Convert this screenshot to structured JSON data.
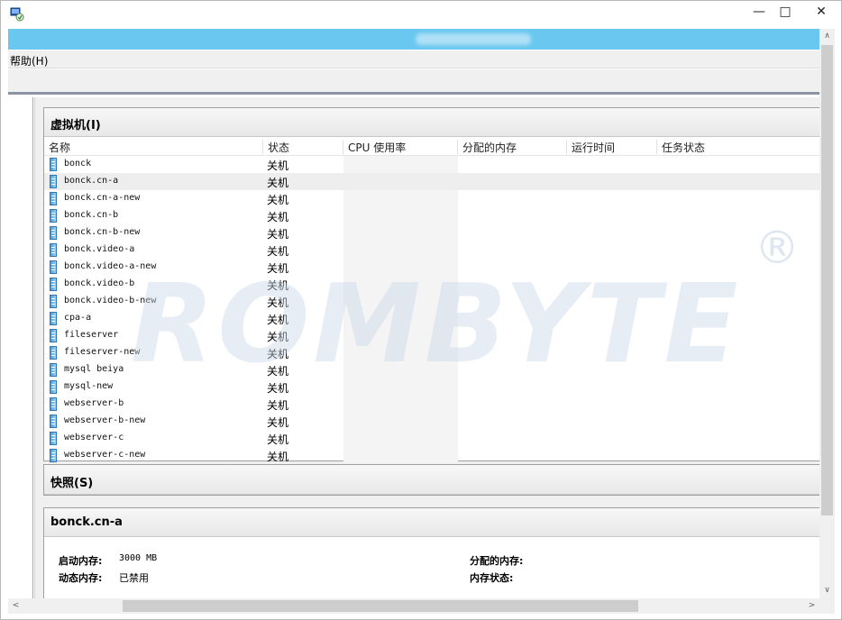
{
  "window": {
    "minimize": "—",
    "maximize": "□",
    "close": "✕"
  },
  "menu": {
    "help": "帮助(H)"
  },
  "vm_panel": {
    "title": "虚拟机(I)",
    "columns": [
      "名称",
      "状态",
      "CPU 使用率",
      "分配的内存",
      "运行时间",
      "任务状态"
    ],
    "rows": [
      {
        "name": "bonck",
        "state": "关机"
      },
      {
        "name": "bonck.cn-a",
        "state": "关机"
      },
      {
        "name": "bonck.cn-a-new",
        "state": "关机"
      },
      {
        "name": "bonck.cn-b",
        "state": "关机"
      },
      {
        "name": "bonck.cn-b-new",
        "state": "关机"
      },
      {
        "name": "bonck.video-a",
        "state": "关机"
      },
      {
        "name": "bonck.video-a-new",
        "state": "关机"
      },
      {
        "name": "bonck.video-b",
        "state": "关机"
      },
      {
        "name": "bonck.video-b-new",
        "state": "关机"
      },
      {
        "name": "cpa-a",
        "state": "关机"
      },
      {
        "name": "fileserver",
        "state": "关机"
      },
      {
        "name": "fileserver-new",
        "state": "关机"
      },
      {
        "name": "mysql beiya",
        "state": "关机"
      },
      {
        "name": "mysql-new",
        "state": "关机"
      },
      {
        "name": "webserver-b",
        "state": "关机"
      },
      {
        "name": "webserver-b-new",
        "state": "关机"
      },
      {
        "name": "webserver-c",
        "state": "关机"
      },
      {
        "name": "webserver-c-new",
        "state": "关机"
      }
    ],
    "selected_index": 1
  },
  "snapshot_panel": {
    "title": "快照(S)"
  },
  "detail_panel": {
    "title": "bonck.cn-a",
    "startup_memory_label": "启动内存:",
    "startup_memory_value": "3000 MB",
    "dynamic_memory_label": "动态内存:",
    "dynamic_memory_value": "已禁用",
    "assigned_memory_label": "分配的内存:",
    "memory_status_label": "内存状态:"
  },
  "watermark": {
    "text": "ROMBYTE",
    "mark": "®"
  },
  "scroll": {
    "up": "∧",
    "down": "∨",
    "left": "<",
    "right": ">"
  }
}
